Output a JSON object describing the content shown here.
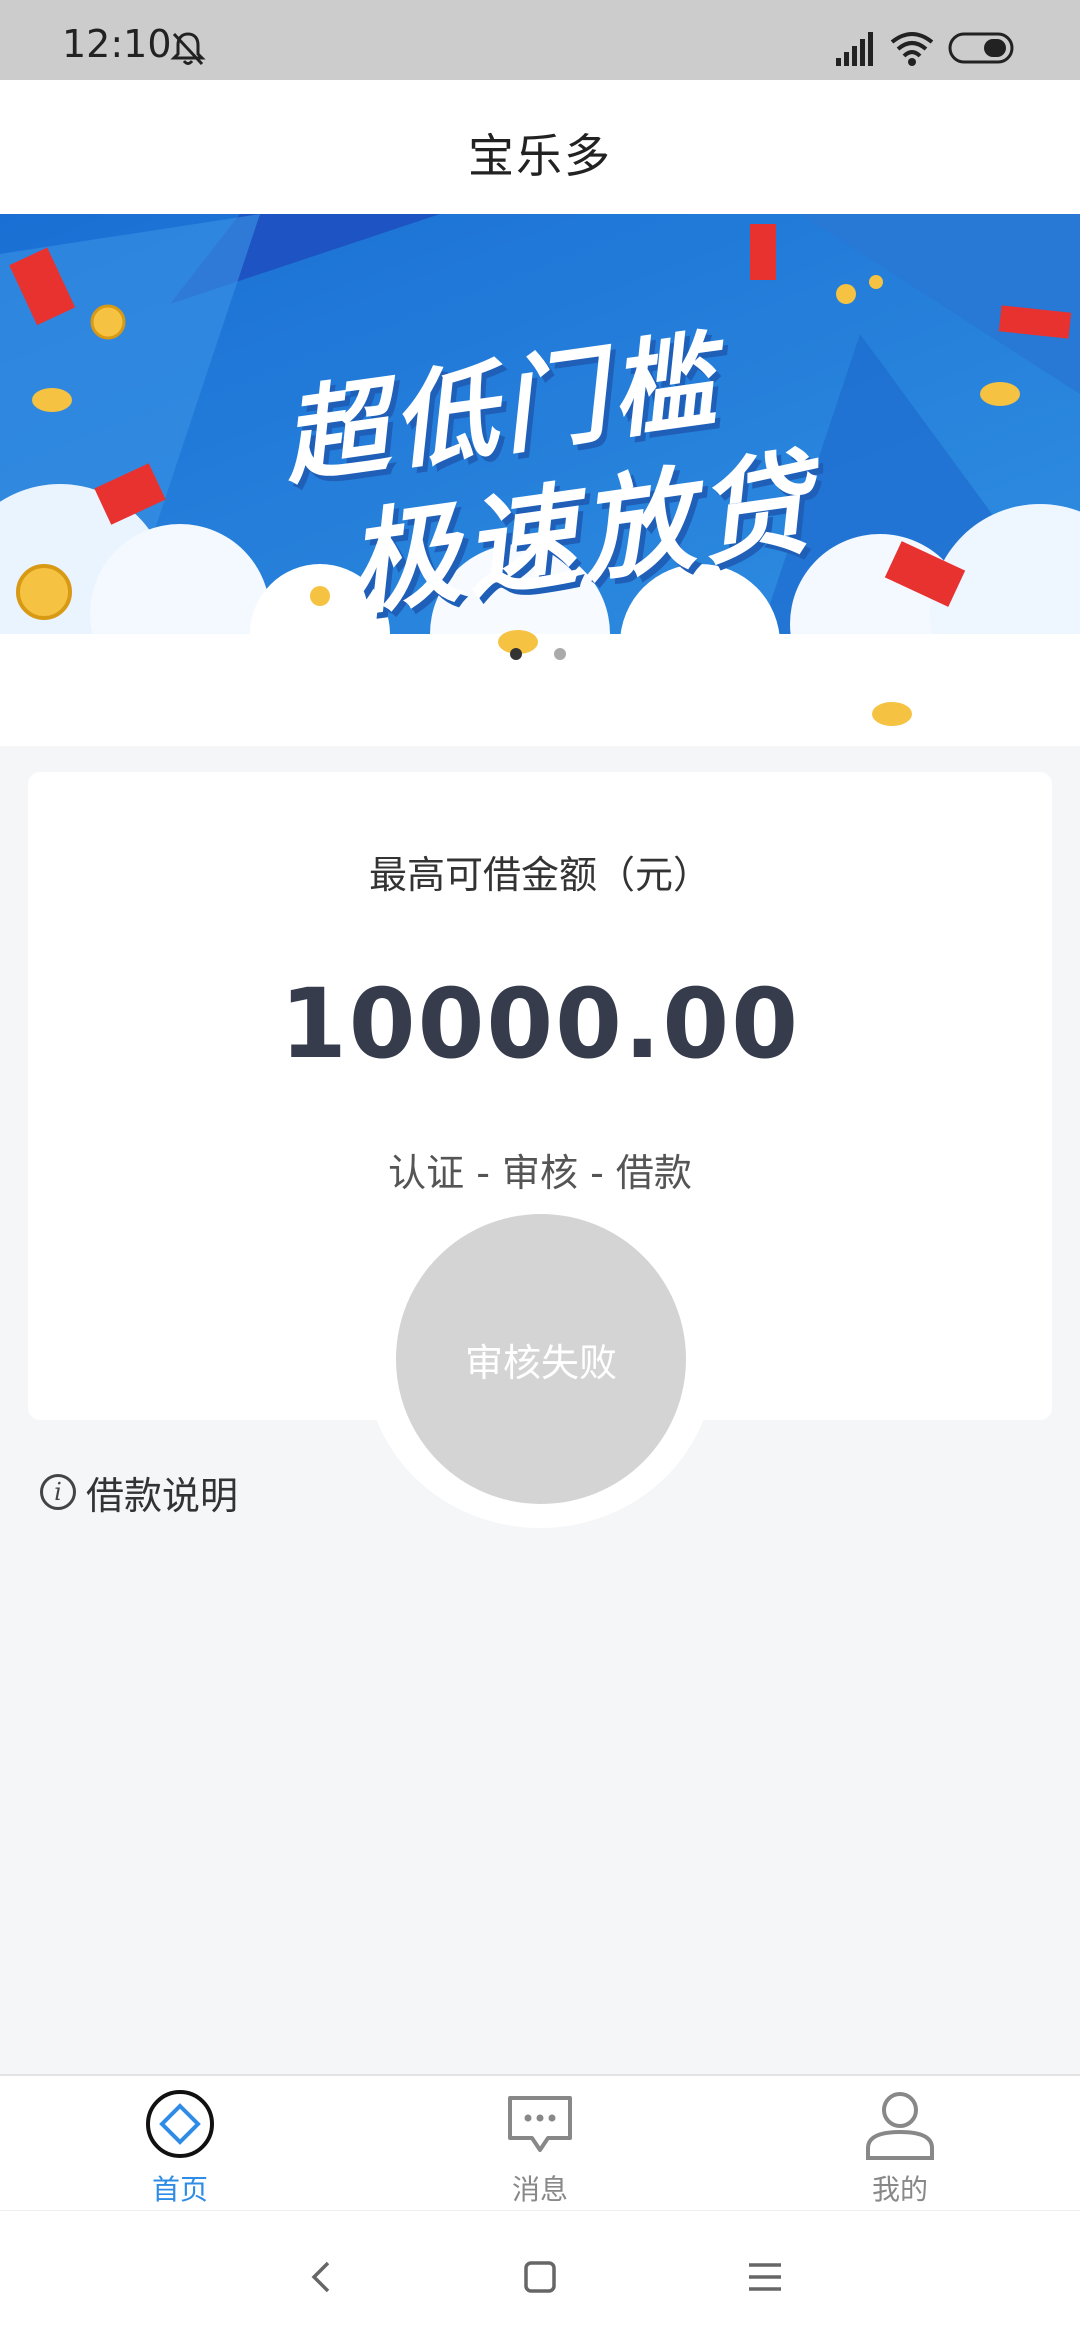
{
  "status_bar": {
    "time": "12:10"
  },
  "header": {
    "title": "宝乐多"
  },
  "banner": {
    "slogan_line1": "超低门槛",
    "slogan_line2": "极速放贷",
    "slide_count": 2,
    "active_slide": 1
  },
  "card": {
    "label": "最高可借金额（元）",
    "amount": "10000.00",
    "steps": "认证 - 审核 - 借款",
    "status_button": "审核失败"
  },
  "loan_info": {
    "label": "借款说明",
    "icon_glyph": "i"
  },
  "bottom_nav": {
    "items": [
      {
        "label": "首页",
        "icon": "home-diamond-icon",
        "active": true
      },
      {
        "label": "消息",
        "icon": "message-bubble-icon",
        "active": false
      },
      {
        "label": "我的",
        "icon": "user-profile-icon",
        "active": false
      }
    ]
  },
  "colors": {
    "accent": "#2e8ce6",
    "amount_text": "#363c4c",
    "status_button_bg": "#d4d4d4",
    "status_bar_bg": "#cccccc",
    "page_bg": "#f5f6f8",
    "banner_blue": "#2a7fd8"
  }
}
